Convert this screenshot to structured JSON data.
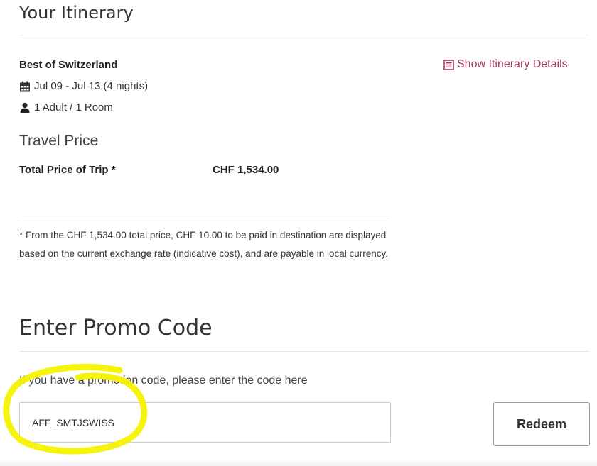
{
  "itinerary": {
    "title": "Your Itinerary",
    "trip_name": "Best of Switzerland",
    "show_details_label": "Show Itinerary Details",
    "dates": "Jul 09 - Jul 13 (4 nights)",
    "guests": "1 Adult / 1 Room"
  },
  "travel_price": {
    "title": "Travel Price",
    "total_label": "Total Price of Trip *",
    "total_value": "CHF 1,534.00",
    "disclaimer": "* From the CHF 1,534.00 total price, CHF 10.00 to be paid in destination are displayed based on the current exchange rate (indicative cost), and are payable in local currency."
  },
  "promo": {
    "title": "Enter Promo Code",
    "instruction": "If you have a promotion code, please enter the code here",
    "input_value": "AFF_SMTJSWISS",
    "redeem_label": "Redeem"
  },
  "colors": {
    "accent": "#a23b5b",
    "highlight": "#f5f200"
  },
  "icons": {
    "details": "list-document-icon",
    "dates": "calendar-icon",
    "guests": "person-icon"
  }
}
